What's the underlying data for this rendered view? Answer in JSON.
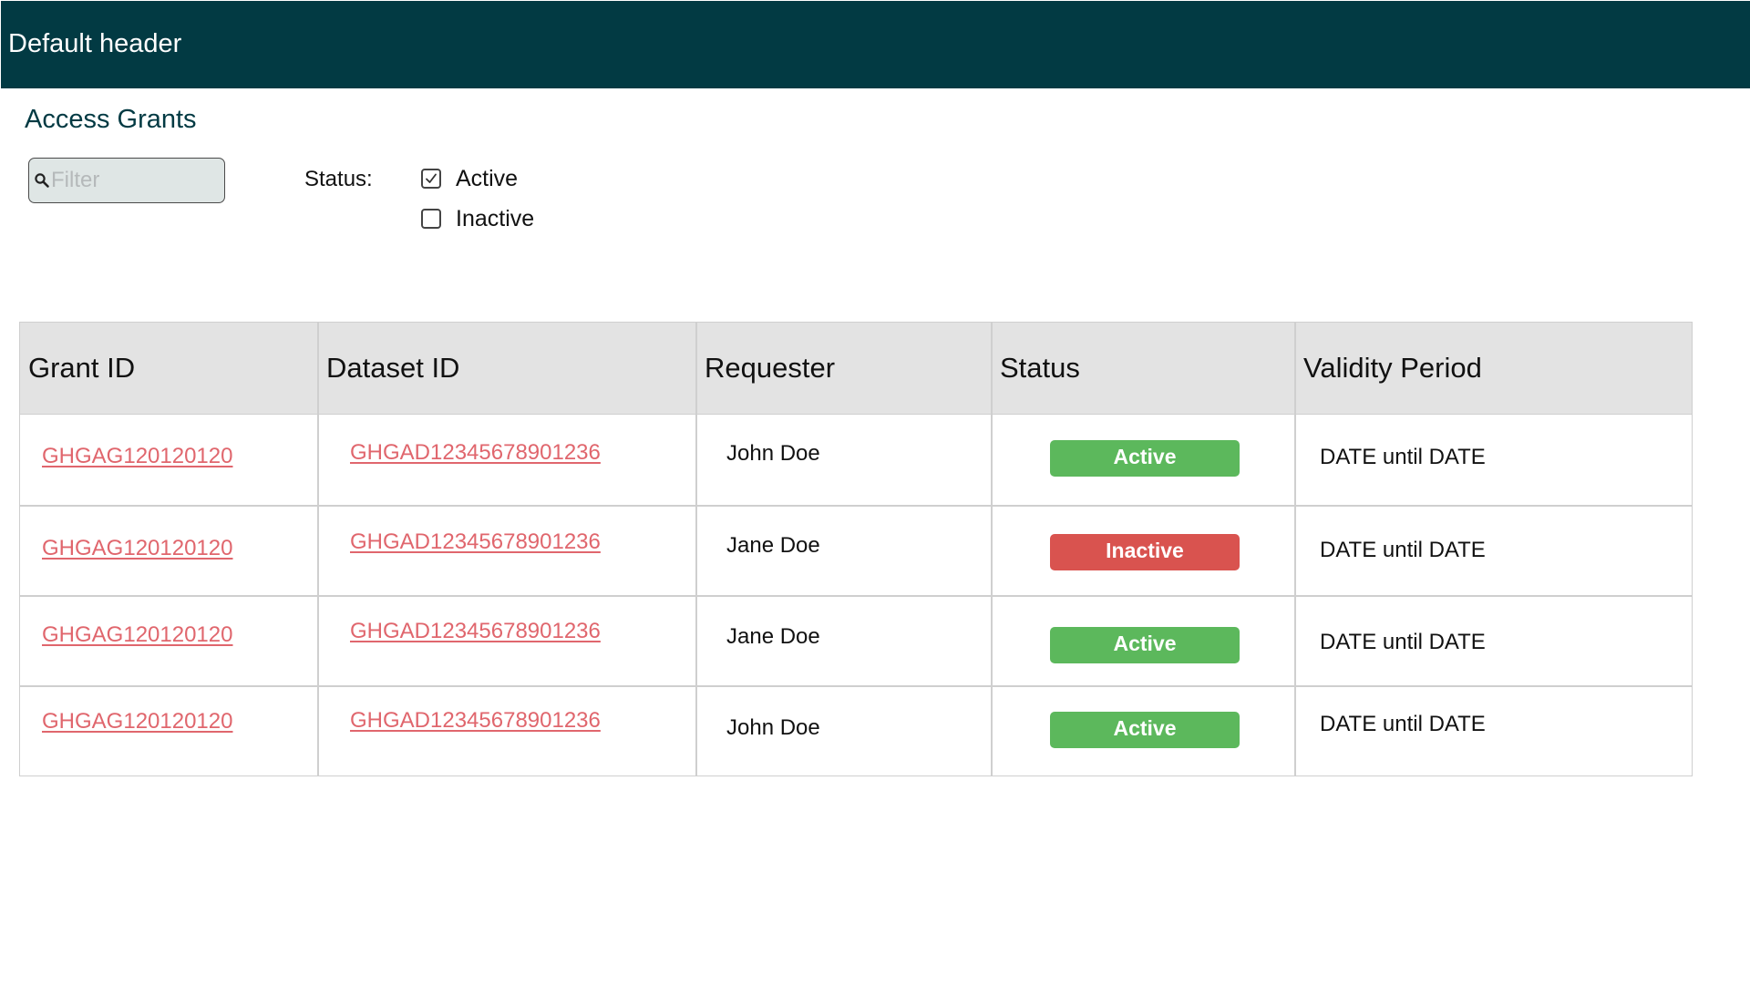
{
  "header": {
    "title": "Default header",
    "background": "#023a43"
  },
  "page": {
    "title": "Access Grants"
  },
  "filter": {
    "value": "",
    "placeholder": "Filter",
    "icon": "search-icon"
  },
  "status_filter": {
    "label": "Status:",
    "options": [
      {
        "label": "Active",
        "checked": true
      },
      {
        "label": "Inactive",
        "checked": false
      }
    ]
  },
  "table": {
    "columns": [
      "Grant ID",
      "Dataset ID",
      "Requester",
      "Status",
      "Validity Period"
    ],
    "rows": [
      {
        "grant_id": "GHGAG120120120",
        "dataset_id": "GHGAD12345678901236",
        "requester": "John Doe",
        "status": "Active",
        "validity": "DATE until DATE"
      },
      {
        "grant_id": "GHGAG120120120",
        "dataset_id": "GHGAD12345678901236",
        "requester": "Jane Doe",
        "status": "Inactive",
        "validity": "DATE until DATE"
      },
      {
        "grant_id": "GHGAG120120120",
        "dataset_id": "GHGAD12345678901236",
        "requester": "Jane Doe",
        "status": "Active",
        "validity": "DATE until DATE"
      },
      {
        "grant_id": "GHGAG120120120",
        "dataset_id": "GHGAD12345678901236",
        "requester": "John Doe",
        "status": "Active",
        "validity": "DATE until DATE"
      }
    ]
  },
  "colors": {
    "link": "#e0666d",
    "active_badge": "#5cb85c",
    "inactive_badge": "#d9534f",
    "table_header": "#e3e3e3"
  }
}
